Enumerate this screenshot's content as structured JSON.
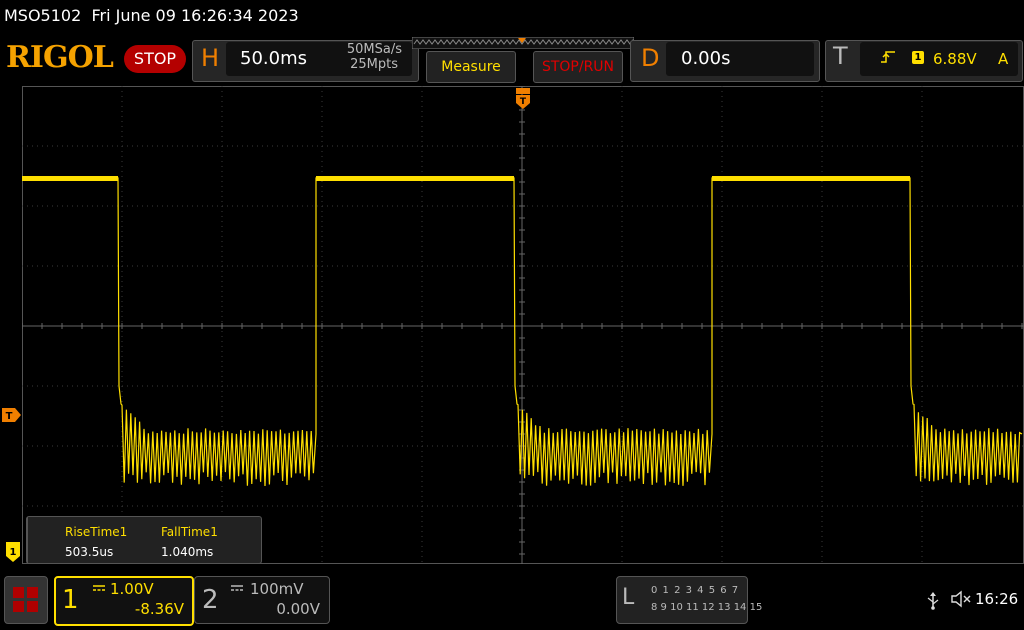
{
  "titlebar": {
    "model": "MSO5102",
    "datetime": "Fri June 09 16:26:34 2023"
  },
  "brand": {
    "logo": "RIGOL",
    "run_state": "STOP"
  },
  "horizontal": {
    "letter": "H",
    "timebase": "50.0ms",
    "sample_rate": "50MSa/s",
    "memory_depth": "25Mpts"
  },
  "buttons": {
    "measure": "Measure",
    "stop_run": "STOP/RUN"
  },
  "delay": {
    "letter": "D",
    "value": "0.00s"
  },
  "trigger": {
    "letter": "T",
    "source": "1",
    "level": "6.88V",
    "mode": "A",
    "slope_icon": "rising-edge-icon"
  },
  "markers": {
    "trigger_position": "T",
    "trigger_level": "T",
    "ch1_ground": "1"
  },
  "measurements": {
    "items": [
      {
        "label": "RiseTime1",
        "value": "503.5us"
      },
      {
        "label": "FallTime1",
        "value": "1.040ms"
      }
    ]
  },
  "channels": {
    "ch1": {
      "num": "1",
      "scale": "1.00V",
      "offset": "-8.36V",
      "coupling_icon": "dc-coupling-icon"
    },
    "ch2": {
      "num": "2",
      "scale": "100mV",
      "offset": "0.00V",
      "coupling_icon": "dc-coupling-icon"
    }
  },
  "logic_analyzer": {
    "letter": "L",
    "row1": "0 1 2 3  4 5 6 7",
    "row2": "8 9 10 11 12 13 14 15"
  },
  "status": {
    "time": "16:26",
    "usb_icon": "usb-icon",
    "speaker_icon": "speaker-muted-icon"
  },
  "colors": {
    "ch1": "#ffdf00",
    "accent_orange": "#f07f00",
    "stop_red": "#b40000"
  },
  "waveform": {
    "channel": 1,
    "type": "square-with-ringing",
    "segments": [
      {
        "state": "high",
        "t0_div": 0.0,
        "t1_div": 1.6
      },
      {
        "state": "low",
        "t0_div": 1.6,
        "t1_div": 4.9
      },
      {
        "state": "high",
        "t0_div": 4.9,
        "t1_div": 8.2
      },
      {
        "state": "low",
        "t0_div": 8.2,
        "t1_div": 11.5
      },
      {
        "state": "high",
        "t0_div": 11.5,
        "t1_div": 14.8
      },
      {
        "state": "low",
        "t0_div": 14.8,
        "t1_div": 16.7
      }
    ]
  }
}
